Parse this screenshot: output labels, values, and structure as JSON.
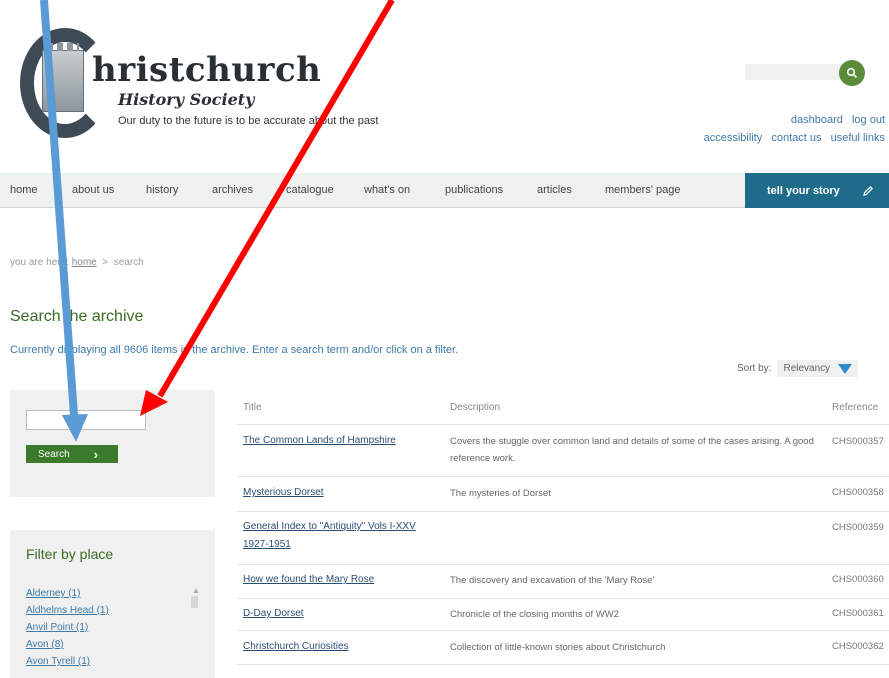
{
  "logo": {
    "title": "hristchurch",
    "subtitle": "History Society",
    "motto": "Our duty to the future is to be accurate about the past"
  },
  "header": {
    "search_placeholder": "",
    "links_row1": [
      "dashboard",
      "log out"
    ],
    "links_row2": [
      "accessibility",
      "contact us",
      "useful links"
    ]
  },
  "nav": {
    "items": [
      "home",
      "about us",
      "history",
      "archives",
      "catalogue",
      "what's on",
      "publications",
      "articles",
      "members' page"
    ],
    "cta": "tell your story"
  },
  "breadcrumb": {
    "prefix": "you are here:",
    "home": "home",
    "sep": ">",
    "current": "search"
  },
  "page": {
    "title": "Search the archive",
    "summary": "Currently displaying all 9606 items in the archive. Enter a search term and/or click on a filter."
  },
  "sort": {
    "label": "Sort by:",
    "value": "Relevancy"
  },
  "search_panel": {
    "input_value": "",
    "button": "Search"
  },
  "filter": {
    "title": "Filter by place",
    "items": [
      "Alderney (1)",
      "Aldhelms Head (1)",
      "Anvil Point (1)",
      "Avon (8)",
      "Avon Tyrell (1)"
    ]
  },
  "table": {
    "headers": [
      "Title",
      "Description",
      "Reference"
    ],
    "rows": [
      {
        "title": "The Common Lands of Hampshire",
        "desc": "Covers the stuggle over common land and details of some of the cases arising. A good reference work.",
        "ref": "CHS000357"
      },
      {
        "title": "Mysterious Dorset",
        "desc": "The mysteries of Dorset",
        "ref": "CHS000358"
      },
      {
        "title": "General Index to \"Antiquity\" Vols I-XXV 1927-1951",
        "desc": "",
        "ref": "CHS000359"
      },
      {
        "title": "How we found the Mary Rose",
        "desc": "The discovery and excavation of the 'Mary Rose'",
        "ref": "CHS000360"
      },
      {
        "title": "D-Day Dorset",
        "desc": "Chronicle of the closing months of WW2",
        "ref": "CHS000361"
      },
      {
        "title": "Christchurch Curiosities",
        "desc": "Collection of little-known stories about Christchurch",
        "ref": "CHS000362"
      }
    ]
  },
  "colors": {
    "nav_bg": "#eef2ee",
    "cta_bg": "#1e6b8a",
    "brand_green": "#3b7a2a",
    "link_blue": "#3d7aa8",
    "arrow_blue": "#5b9bd5",
    "arrow_red": "#ff0000"
  }
}
